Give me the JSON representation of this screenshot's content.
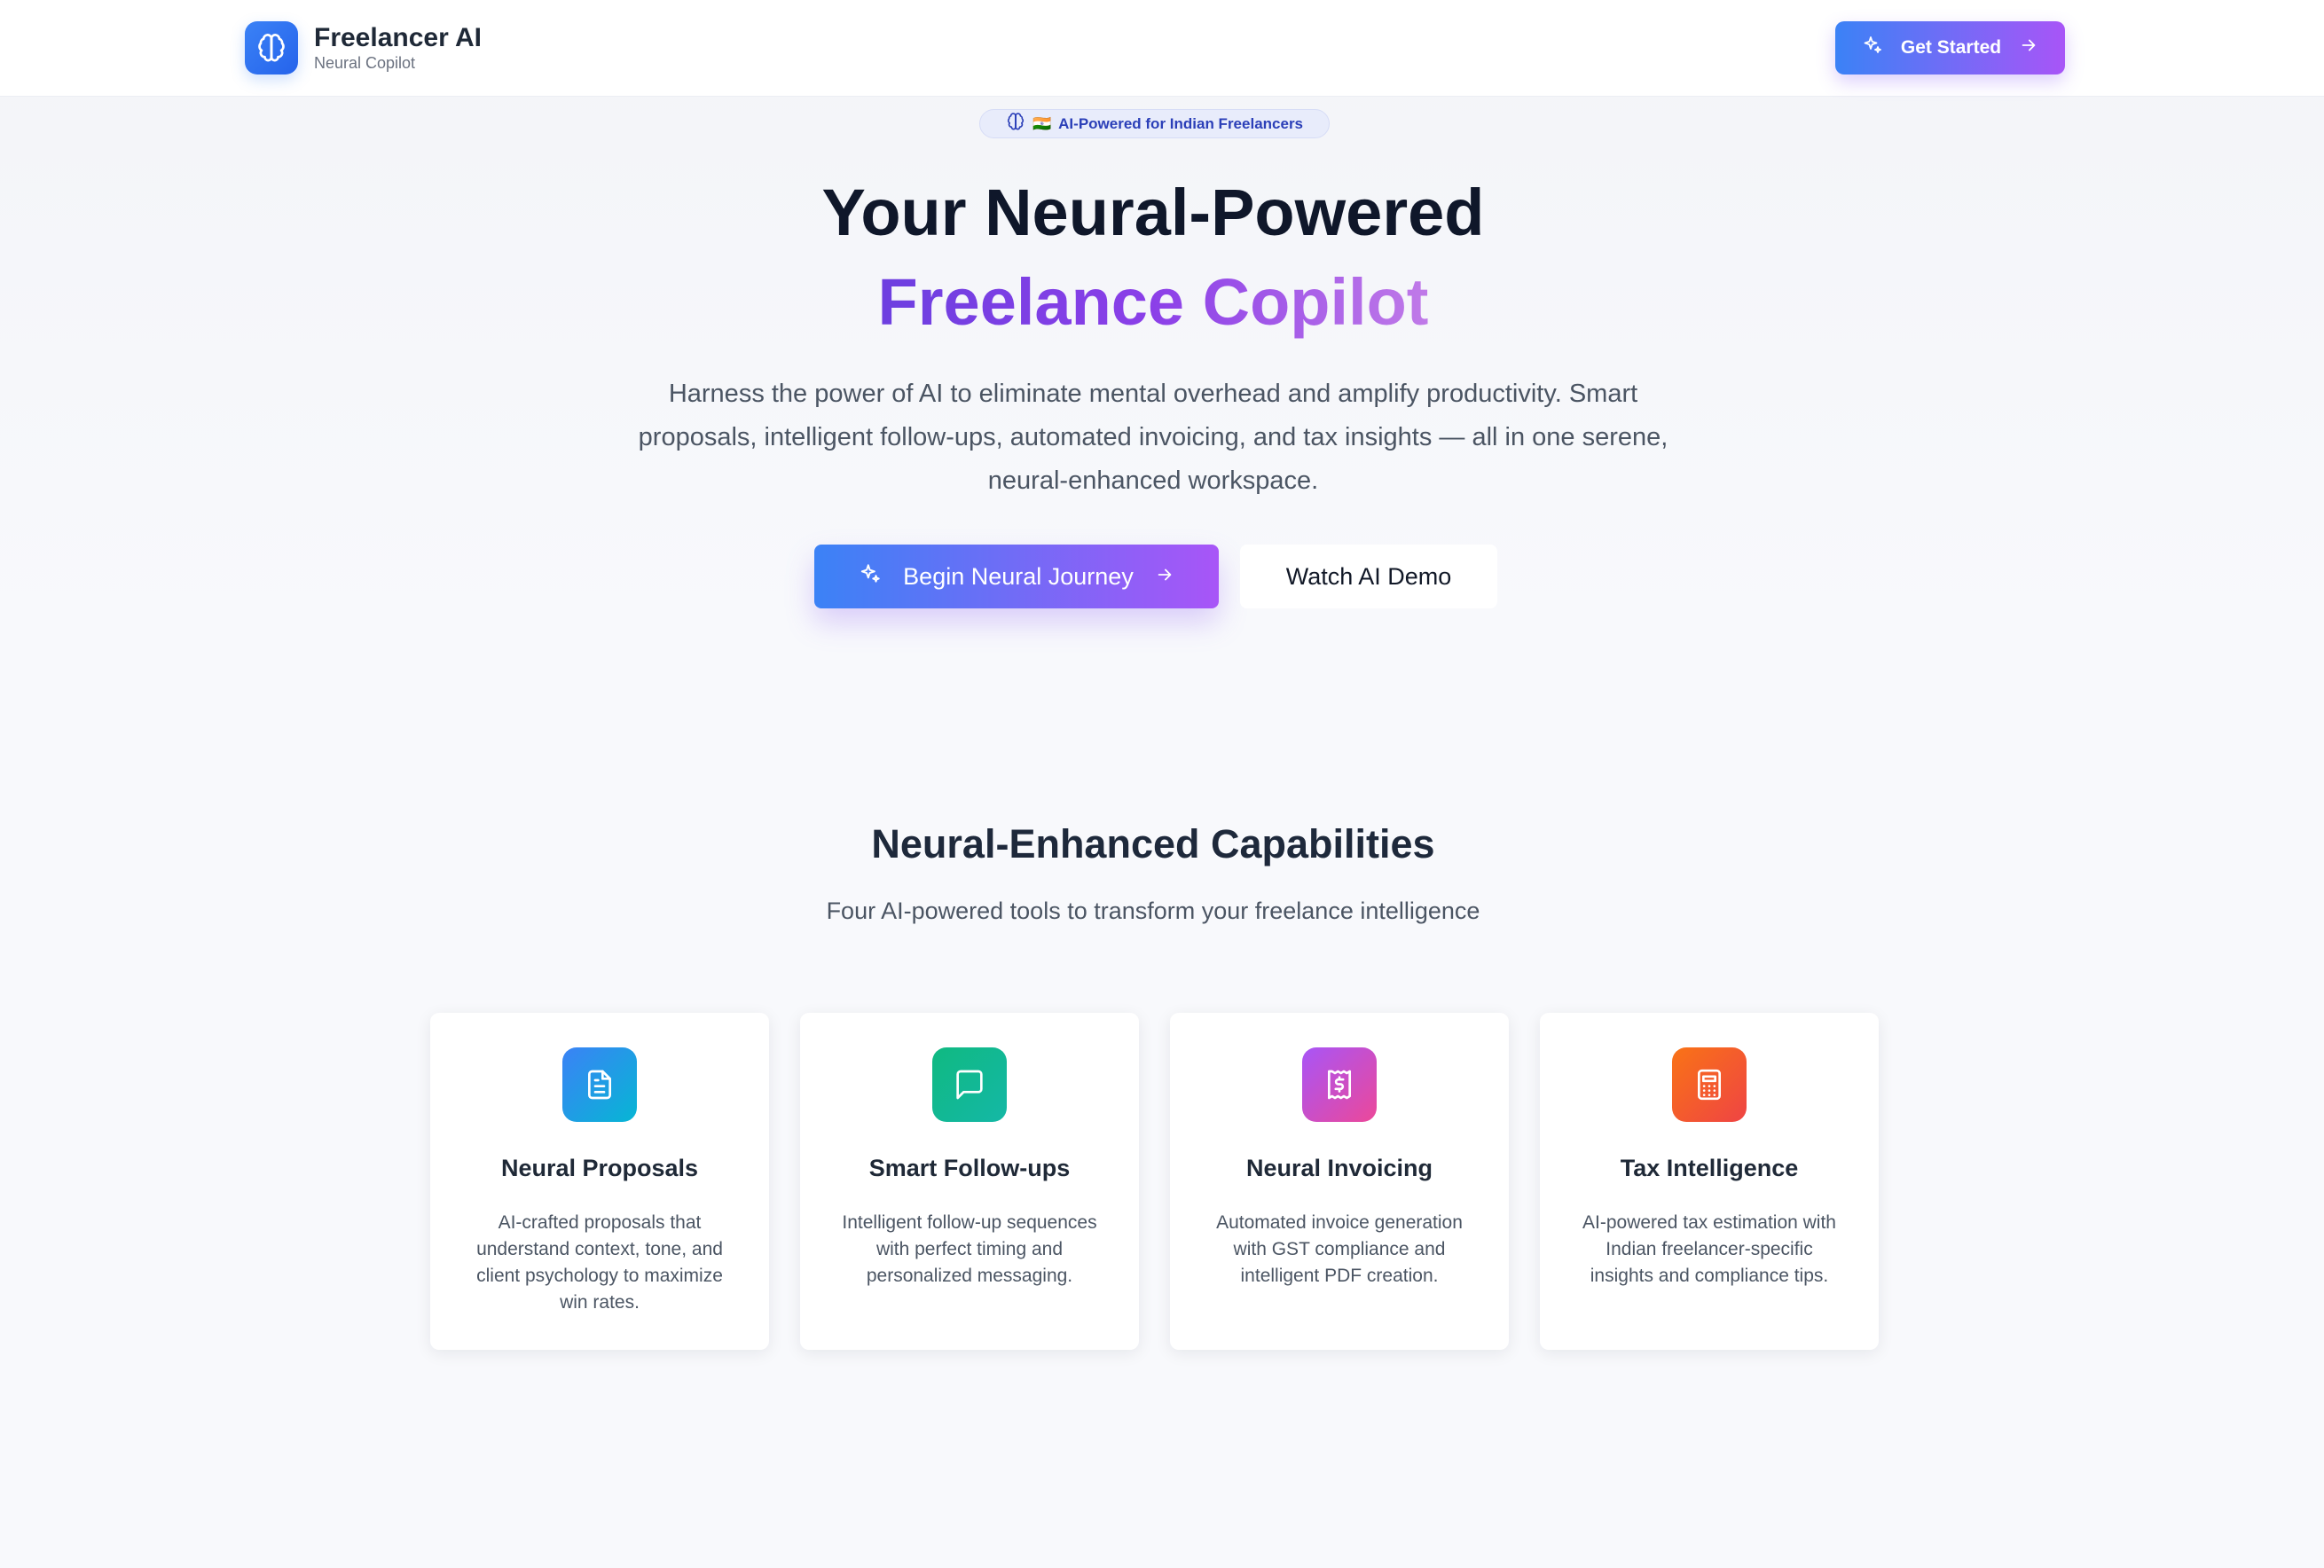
{
  "header": {
    "brand_name": "Freelancer AI",
    "brand_sub": "Neural Copilot",
    "logo_icon": "brain-icon",
    "cta_label": "Get Started",
    "cta_icon_left": "sparkles-icon",
    "cta_icon_right": "arrow-right-icon"
  },
  "hero": {
    "badge_icon": "brain-icon",
    "badge_flag": "🇮🇳",
    "badge_text": "AI-Powered for Indian Freelancers",
    "title_line1": "Your Neural-Powered",
    "title_line2": "Freelance Copilot",
    "description": "Harness the power of AI to eliminate mental overhead and amplify productivity. Smart proposals, intelligent follow-ups, automated invoicing, and tax insights — all in one serene, neural-enhanced workspace.",
    "primary_label": "Begin Neural Journey",
    "secondary_label": "Watch AI Demo"
  },
  "features": {
    "title": "Neural-Enhanced Capabilities",
    "subtitle": "Four AI-powered tools to transform your freelance intelligence",
    "cards": [
      {
        "icon": "document-icon",
        "title": "Neural Proposals",
        "description": "AI-crafted proposals that understand context, tone, and client psychology to maximize win rates."
      },
      {
        "icon": "message-icon",
        "title": "Smart Follow-ups",
        "description": "Intelligent follow-up sequences with perfect timing and personalized messaging."
      },
      {
        "icon": "receipt-icon",
        "title": "Neural Invoicing",
        "description": "Automated invoice generation with GST compliance and intelligent PDF creation."
      },
      {
        "icon": "calculator-icon",
        "title": "Tax Intelligence",
        "description": "AI-powered tax estimation with Indian freelancer-specific insights and compliance tips."
      }
    ]
  },
  "colors": {
    "primary_blue": "#3b82f6",
    "primary_purple": "#a855f7",
    "card1_gradient": [
      "#3b82f6",
      "#06b6d4"
    ],
    "card2_gradient": [
      "#10b981",
      "#14b8a6"
    ],
    "card3_gradient": [
      "#a855f7",
      "#ec4899"
    ],
    "card4_gradient": [
      "#f97316",
      "#ef4444"
    ]
  }
}
